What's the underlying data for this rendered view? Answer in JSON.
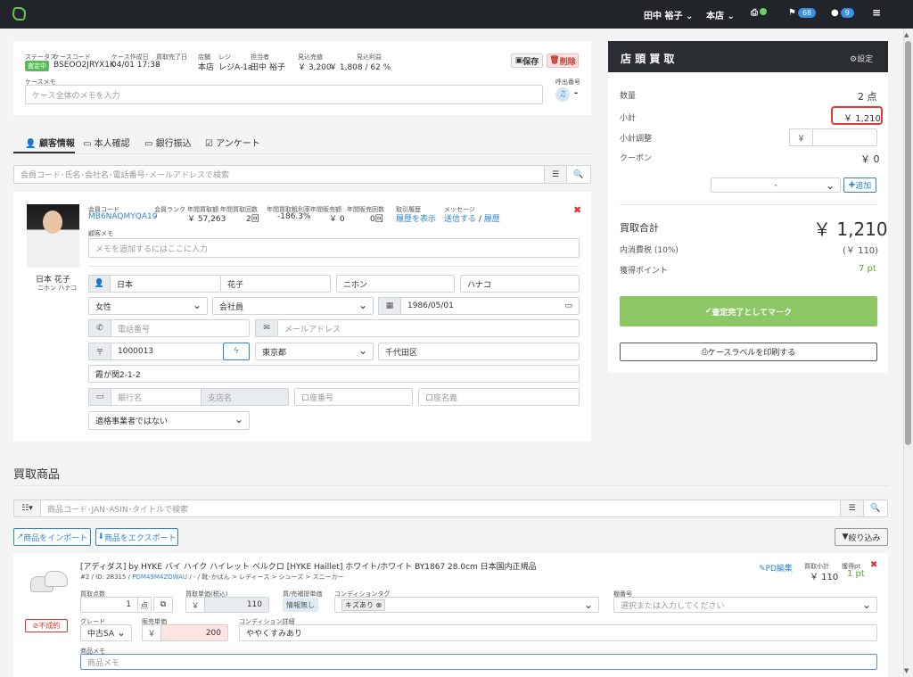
{
  "topbar": {
    "user": "田中 裕子",
    "store": "本店",
    "printer_icon": "printer-icon",
    "flag_count": "68",
    "chat_count": "9"
  },
  "case": {
    "status_label": "ステータス",
    "status": "査定中",
    "code_label": "ケースコード",
    "code": "BSEOO2JRYX1K",
    "created_label": "ケース作成日",
    "created": "04/01 17:38",
    "done_label": "買取完了日",
    "done": "-",
    "store_label": "店舗",
    "store": "本店",
    "register_label": "レジ",
    "register": "レジA-1a",
    "staff_label": "担当者",
    "staff": "田中 裕子",
    "est_sale_label": "見込売値",
    "est_sale": "￥ 3,200",
    "est_profit_label": "見込利益",
    "est_profit": "￥ 1,808 / 62 %",
    "save": "保存",
    "delete": "削除",
    "memo_label": "ケースメモ",
    "memo_placeholder": "ケース全体のメモを入力",
    "call_label": "呼出番号",
    "call_value": "-"
  },
  "tabs": [
    "顧客情報",
    "本人確認",
    "銀行振込",
    "アンケート"
  ],
  "customer_search_placeholder": "会員コード･氏名･会社名･電話番号･メールアドレスで検索",
  "customer": {
    "name": "日本 花子",
    "kana": "ニホン ハナコ",
    "member_code_label": "会員コード",
    "member_code": "MB6NAQMYQA10",
    "rank_label": "会員ランク",
    "rank": "-",
    "annual_amount_label": "年間買取額",
    "annual_amount": "￥ 57,263",
    "annual_count_label": "年間買取回数",
    "annual_count": "2回",
    "profit_rate_label": "年間買取粗利率",
    "profit_rate": "-186.3%",
    "sales_amount_label": "年間販売額",
    "sales_amount": "￥ 0",
    "sales_count_label": "年間販売回数",
    "sales_count": "0回",
    "history_label": "取引履歴",
    "history_link": "履歴を表示",
    "message_label": "メッセージ",
    "send": "送信する",
    "msg_history": "履歴",
    "memo_label": "顧客メモ",
    "memo_placeholder": "メモを追加するにはここに入力",
    "last": "日本",
    "first": "花子",
    "last_kana": "ニホン",
    "first_kana": "ハナコ",
    "gender": "女性",
    "type": "会社員",
    "birth": "1986/05/01",
    "phone_placeholder": "電話番号",
    "email_placeholder": "メールアドレス",
    "zip": "1000013",
    "pref": "東京都",
    "city": "千代田区",
    "address": "霞が関2-1-2",
    "bank_placeholder": "銀行名",
    "branch_placeholder": "支店名",
    "account_placeholder": "口座番号",
    "holder_placeholder": "口座名義",
    "invoice": "適格事業者ではない"
  },
  "summary": {
    "title": "店 頭 買 取",
    "settings": "設定",
    "qty_label": "数量",
    "qty": "2 点",
    "subtotal_label": "小計",
    "subtotal": "￥ 1,210",
    "adjust_label": "小計調整",
    "yen": "￥",
    "coupon_label": "クーポン",
    "coupon": "￥ 0",
    "coupon_select": "-",
    "add": "追加",
    "total_label": "買取合計",
    "total": "￥ 1,210",
    "tax_label": "内消費税 (10%)",
    "tax": "(￥ 110)",
    "points_label": "獲得ポイント",
    "points": "7 pt",
    "complete": "査定完了としてマーク",
    "print": "ケースラベルを印刷する"
  },
  "products": {
    "title": "買取商品",
    "search_placeholder": "商品コード･JAN･ASIN･タイトルで検索",
    "import": "商品をインポート",
    "export": "商品をエクスポート",
    "filter": "絞り込み"
  },
  "item": {
    "title": "[アディダス] by HYKE バイ ハイク ハイレット ベルクロ [HYKE Haillet] ホワイト/ホワイト BY1867 28.0cm 日本国内正規品",
    "meta_prefix": "#2 / ID: 28315 /",
    "meta_link": "PDM49M4ZOWAU",
    "meta_suffix": "/ - / 靴･かばん > レディース > シューズ > スニーカー",
    "pd_edit": "PD編集",
    "subtotal_label": "買取小計",
    "subtotal": "￥ 110",
    "points_label": "獲得pt",
    "points": "1 pt",
    "qty_label": "買取点数",
    "qty": "1",
    "unit": "点",
    "price_label": "買取単価(税込)",
    "yen": "￥",
    "price": "110",
    "ref_label": "買/売補提単価",
    "ref_value": "情報無し",
    "cond_tag_label": "コンディションタグ",
    "cond_tag": "キズあり",
    "shelf_label": "棚番号",
    "shelf_placeholder": "選択または入力してください",
    "grade_label": "グレード",
    "grade": "中古SA",
    "sale_label": "販売単価",
    "sale_price": "200",
    "cond_detail_label": "コンディション詳細",
    "cond_detail": "ややくすみあり",
    "memo_label": "商品メモ",
    "memo_placeholder": "商品メモ",
    "unsettled": "不成約"
  }
}
